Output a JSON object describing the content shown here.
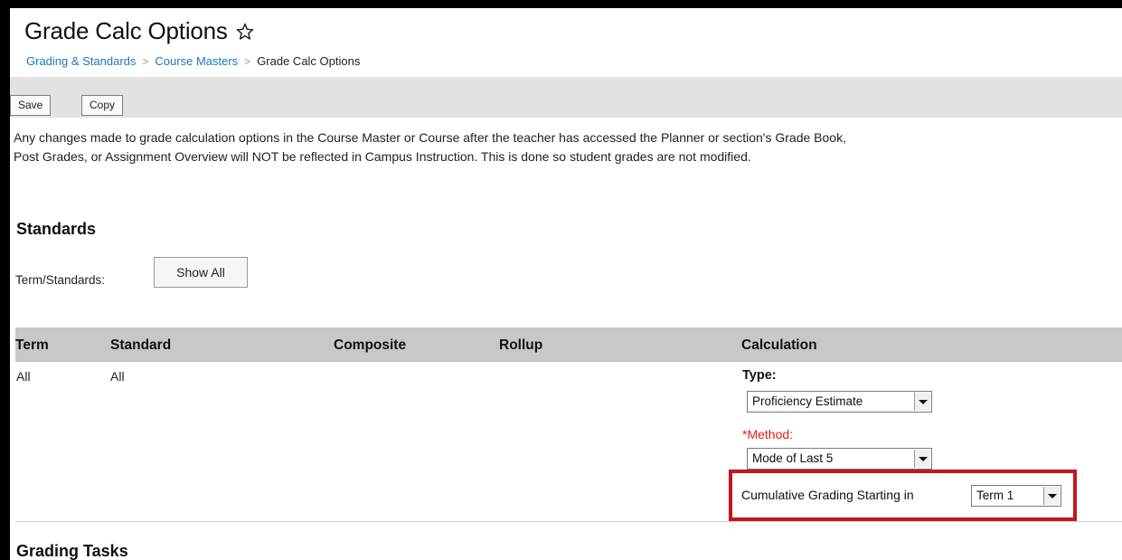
{
  "header": {
    "title": "Grade Calc Options"
  },
  "breadcrumb": {
    "items": [
      "Grading & Standards",
      "Course Masters"
    ],
    "current": "Grade Calc Options"
  },
  "toolbar": {
    "save_label": "Save",
    "copy_label": "Copy"
  },
  "notice": {
    "line1": "Any changes made to grade calculation options in the Course Master or Course after the teacher has accessed the Planner or section's Grade Book,",
    "line2": "Post Grades, or Assignment Overview will NOT be reflected in Campus Instruction. This is done so student grades are not modified."
  },
  "standards": {
    "section_title": "Standards",
    "term_standards_label": "Term/Standards:",
    "show_all_label": "Show All",
    "columns": [
      "Term",
      "Standard",
      "Composite",
      "Rollup",
      "Calculation"
    ],
    "rows": [
      {
        "term": "All",
        "standard": "All"
      }
    ],
    "calculation": {
      "type_label": "Type:",
      "type_value": "Proficiency Estimate",
      "method_label": "*Method:",
      "method_value": "Mode of Last 5",
      "cumulative_label": "Cumulative Grading Starting in",
      "cumulative_value": "Term 1"
    }
  },
  "grading_tasks": {
    "section_title": "Grading Tasks"
  },
  "colors": {
    "link": "#2276bb",
    "required": "#e01b1b",
    "highlight_border": "#c4161c",
    "header_bg": "#c8c8c8",
    "toolbar_bg": "#e2e2e2"
  },
  "icons": [
    "star-outline-icon",
    "chevron-right-icon",
    "dropdown-arrow-icon"
  ]
}
